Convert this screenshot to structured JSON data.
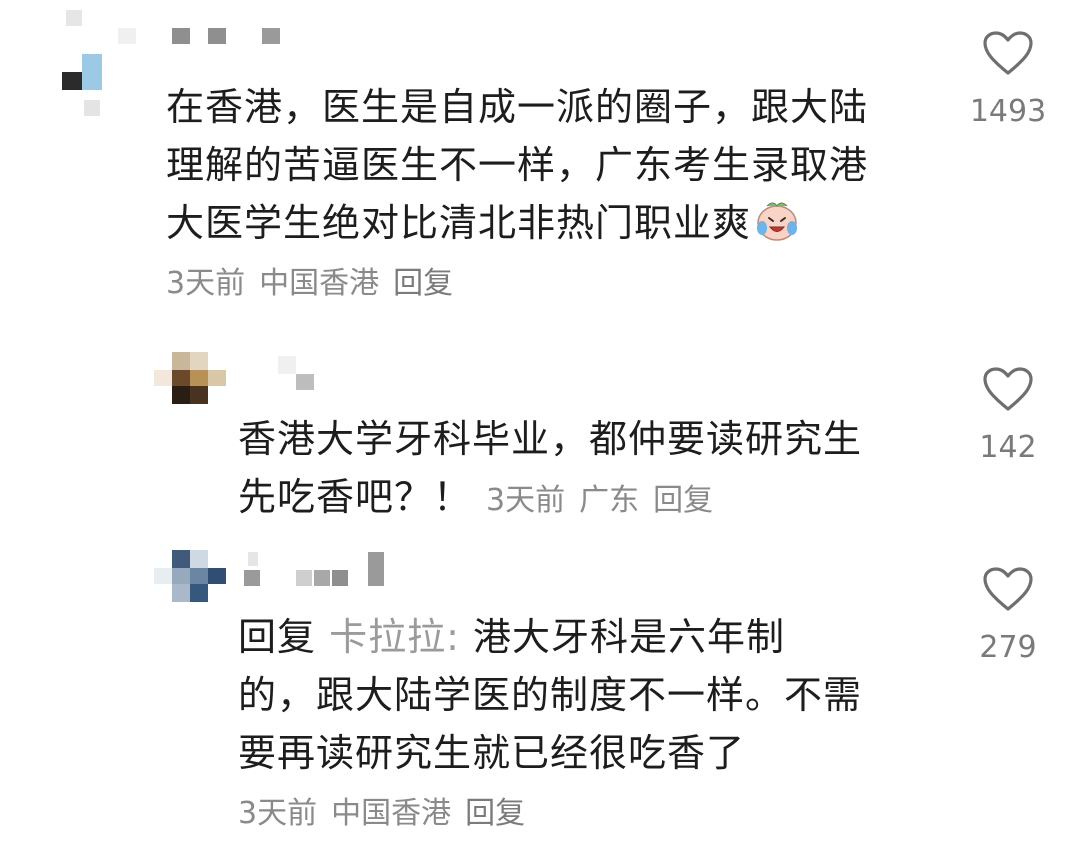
{
  "comments": [
    {
      "text": "在香港，医生是自成一派的圈子，跟大陆理解的苦逼医生不一样，广东考生录取港大医学生绝对比清北非热门职业爽",
      "lines": [
        "在香港，医生是自成一派的圈子，跟大陆",
        "理解的苦逼医生不一样，广东考生录取港",
        "大医学生绝对比清北非热门职业爽"
      ],
      "emoji": "crying-laughing-emoji",
      "time": "3天前",
      "location": "中国香港",
      "reply_label": "回复",
      "likes": "1493",
      "like_icon": "heart-outline-icon"
    },
    {
      "lines": [
        "香港大学牙科毕业，都仲要读研究生",
        "先吃香吧？！"
      ],
      "time": "3天前",
      "location": "广东",
      "reply_label": "回复",
      "likes": "142",
      "like_icon": "heart-outline-icon"
    },
    {
      "reply_prefix": "回复",
      "mention": "卡拉拉:",
      "lines_first": "港大牙科是六年制",
      "lines": [
        "的，跟大陆学医的制度不一样。不需",
        "要再读研究生就已经很吃香了"
      ],
      "time": "3天前",
      "location": "中国香港",
      "reply_label": "回复",
      "likes": "279",
      "like_icon": "heart-outline-icon"
    }
  ],
  "colors": {
    "text": "#1d1d1d",
    "meta": "#8a8a8a",
    "icon": "#6f6f6f"
  }
}
